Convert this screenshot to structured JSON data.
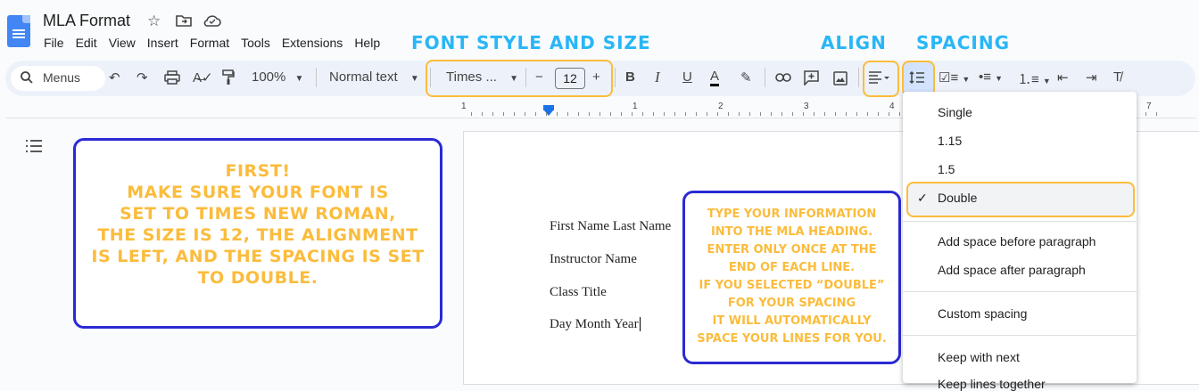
{
  "doc": {
    "title": "MLA Format",
    "star_icon": "☆",
    "folder_icon": "⊡",
    "cloud_icon": "☁"
  },
  "menubar": [
    "File",
    "Edit",
    "View",
    "Insert",
    "Format",
    "Tools",
    "Extensions",
    "Help"
  ],
  "header_labels": {
    "font": "FONT STYLE AND SIZE",
    "align": "ALIGN",
    "spacing": "SPACING"
  },
  "toolbar": {
    "menus_label": "Menus",
    "zoom": "100%",
    "style": "Normal text",
    "font": "Times ...",
    "font_size": "12",
    "minus": "−",
    "plus": "+",
    "bold": "B",
    "italic": "I",
    "underline": "U",
    "text_color": "A",
    "highlight_color": "#fbbc3c"
  },
  "ruler": {
    "numbers": [
      "1",
      "1",
      "2",
      "3",
      "4",
      "7"
    ]
  },
  "callouts": {
    "left": [
      "FIRST!",
      "MAKE SURE YOUR FONT IS",
      "SET TO TIMES  NEW ROMAN,",
      "THE SIZE IS 12, THE ALIGNMENT",
      "IS LEFT, AND THE SPACING IS SET",
      "TO DOUBLE."
    ],
    "right": [
      "TYPE YOUR INFORMATION",
      "INTO THE MLA HEADING.",
      "ENTER ONLY ONCE AT THE",
      "END OF EACH LINE.",
      "IF YOU SELECTED “DOUBLE”",
      "FOR YOUR SPACING",
      "IT WILL AUTOMATICALLY",
      "SPACE YOUR LINES FOR YOU."
    ]
  },
  "document_lines": [
    "First Name Last Name",
    "Instructor Name",
    "Class Title",
    "Day Month Year"
  ],
  "spacing_menu": {
    "items": [
      "Single",
      "1.15",
      "1.5",
      "Double"
    ],
    "selected": "Double",
    "paragraph": [
      "Add space before paragraph",
      "Add space after paragraph"
    ],
    "custom": "Custom spacing",
    "keep": [
      "Keep with next",
      "Keep lines together"
    ]
  },
  "colors": {
    "accent": "#fbbc3c",
    "label_blue": "#29b6f6",
    "callout_border": "#2a2ad4"
  }
}
